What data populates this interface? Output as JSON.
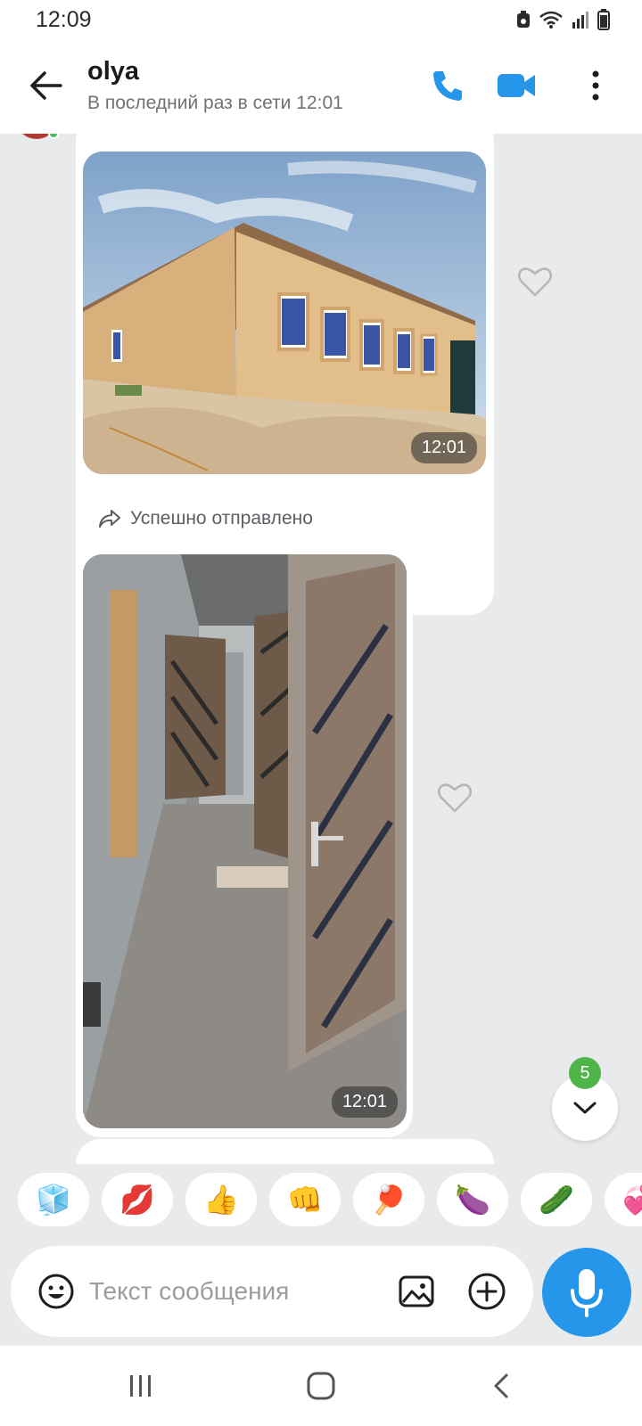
{
  "status_bar": {
    "time": "12:09",
    "icons": [
      "recycle-icon",
      "wifi-icon",
      "signal-icon",
      "battery-icon"
    ]
  },
  "header": {
    "contact_name": "olya",
    "contact_status": "В последний раз в сети 12:01",
    "icons": [
      "back-arrow-icon",
      "phone-icon",
      "video-icon",
      "more-icon"
    ]
  },
  "messages": [
    {
      "type": "photo",
      "time": "12:01",
      "liked": false
    },
    {
      "type": "photo",
      "forward_label": "Успешно отправлено",
      "time": "12:01",
      "liked": false
    }
  ],
  "scroll_down": {
    "unread_count": "5"
  },
  "stickers": [
    "🧊",
    "💋",
    "👍",
    "👊",
    "🏓",
    "🍆",
    "🥒",
    "💞"
  ],
  "composer": {
    "placeholder": "Текст сообщения",
    "icons": [
      "emoji-icon",
      "gallery-icon",
      "plus-icon",
      "microphone-icon"
    ]
  },
  "colors": {
    "accent": "#2696ea",
    "badge": "#4fb548",
    "background": "#e9eaeb"
  }
}
